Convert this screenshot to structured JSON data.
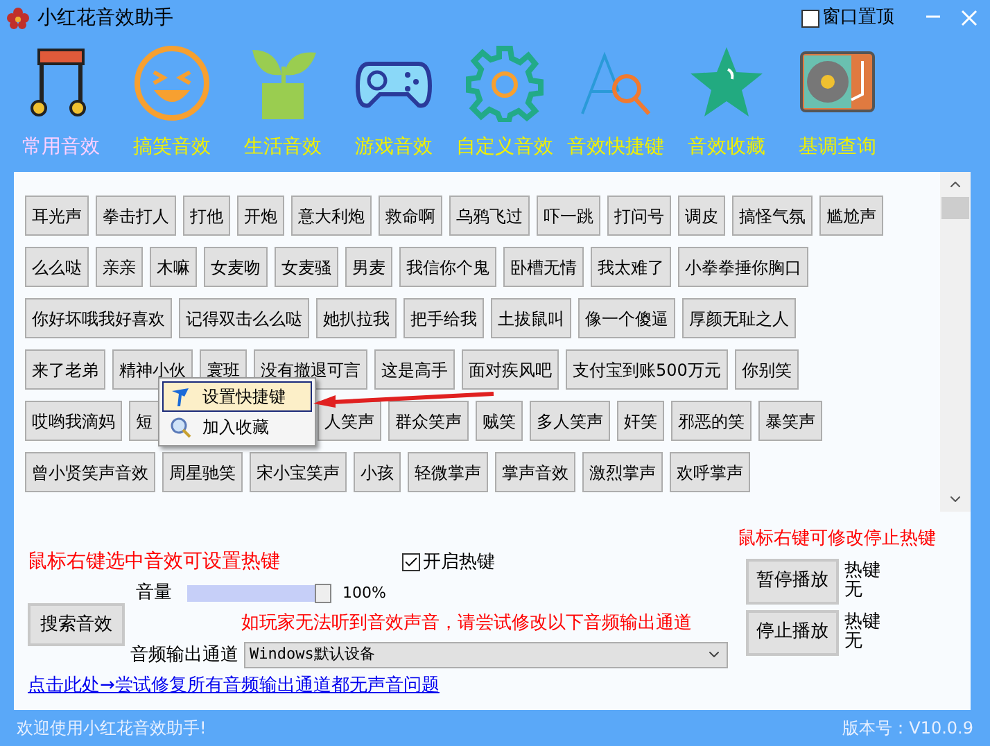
{
  "window": {
    "title": "小红花音效助手",
    "pin_checkbox": {
      "label": "窗口置顶",
      "checked": false
    }
  },
  "categories": [
    {
      "label": "常用音效",
      "kind": "music",
      "selected": true
    },
    {
      "label": "搞笑音效",
      "kind": "laugh",
      "selected": false
    },
    {
      "label": "生活音效",
      "kind": "plant",
      "selected": false
    },
    {
      "label": "游戏音效",
      "kind": "gamepad",
      "selected": false
    },
    {
      "label": "自定义音效",
      "kind": "gear",
      "selected": false
    },
    {
      "label": "音效快捷键",
      "kind": "search",
      "selected": false
    },
    {
      "label": "音效收藏",
      "kind": "star",
      "selected": false
    },
    {
      "label": "基调查询",
      "kind": "record",
      "selected": false
    }
  ],
  "sound_rows": [
    [
      "耳光声",
      "拳击打人",
      "打他",
      "开炮",
      "意大利炮",
      "救命啊",
      "乌鸦飞过",
      "吓一跳",
      "打问号",
      "调皮",
      "搞怪气氛",
      "尴尬声"
    ],
    [
      "么么哒",
      "亲亲",
      "木嘛",
      "女麦吻",
      "女麦骚",
      "男麦",
      "我信你个鬼",
      "卧槽无情",
      "我太难了",
      "小拳拳捶你胸口"
    ],
    [
      "你好坏哦我好喜欢",
      "记得双击么么哒",
      "她扒拉我",
      "把手给我",
      "土拔鼠叫",
      "像一个傻逼",
      "厚颜无耻之人"
    ],
    [
      "来了老弟",
      "精神小伙",
      "寰班",
      "没有撤退可言",
      "这是高手",
      "面对疾风吧",
      "支付宝到账500万元",
      "你别笑"
    ],
    [
      "哎哟我滴妈",
      {
        "label": "短",
        "kind": "cut_right"
      },
      {
        "label": "人笑声",
        "kind": "cut_left"
      },
      "群众笑声",
      "贼笑",
      "多人笑声",
      "奸笑",
      "邪恶的笑",
      "暴笑声"
    ],
    [
      "曾小贤笑声音效",
      "周星驰笑",
      "宋小宝笑声",
      "小孩",
      "轻微掌声",
      "掌声音效",
      "激烈掌声",
      "欢呼掌声"
    ]
  ],
  "context_menu": [
    {
      "label": "设置快捷键",
      "kind": "shortcut",
      "selected": true
    },
    {
      "label": "加入收藏",
      "kind": "favorite",
      "selected": false
    }
  ],
  "hint_left": "鼠标右键选中音效可设置热键",
  "hotkey_checkbox": {
    "label": "开启热键",
    "checked": true
  },
  "search_button": "搜索音效",
  "volume": {
    "label": "音量",
    "level": 1.0,
    "reading": "100%"
  },
  "output_hint": "如玩家无法听到音效声音，请尝试修改以下音频输出通道",
  "output": {
    "label": "音频输出通道",
    "value": "Windows默认设备"
  },
  "fix_link": "点击此处→尝试修复所有音频输出通道都无声音问题",
  "hint_right": "鼠标右键可修改停止热键",
  "playback_buttons": [
    {
      "label": "暂停播放",
      "hotkey_label": "热键",
      "hotkey": "无"
    },
    {
      "label": "停止播放",
      "hotkey_label": "热键",
      "hotkey": "无"
    }
  ],
  "status_bar": {
    "message": "欢迎使用小红花音效助手!",
    "version": "版本号：V10.0.9"
  }
}
